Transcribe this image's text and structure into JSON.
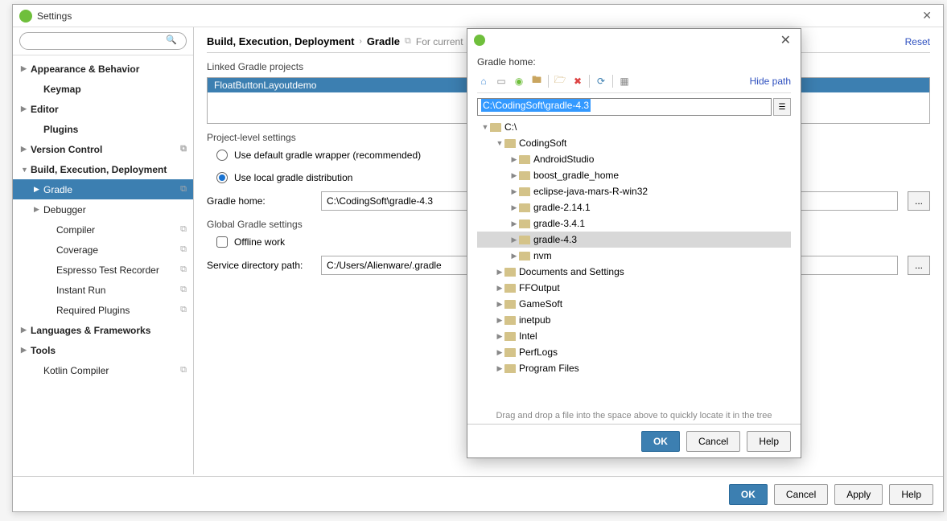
{
  "window": {
    "title": "Settings",
    "close": "✕"
  },
  "sidebar": {
    "search_placeholder": "",
    "items": [
      {
        "label": "Appearance & Behavior",
        "bold": true,
        "arrow": "▶",
        "level": 0
      },
      {
        "label": "Keymap",
        "bold": true,
        "level": 1
      },
      {
        "label": "Editor",
        "bold": true,
        "arrow": "▶",
        "level": 0
      },
      {
        "label": "Plugins",
        "bold": true,
        "level": 1
      },
      {
        "label": "Version Control",
        "bold": true,
        "arrow": "▶",
        "level": 0,
        "copy": true
      },
      {
        "label": "Build, Execution, Deployment",
        "bold": true,
        "arrow": "▼",
        "level": 0
      },
      {
        "label": "Gradle",
        "arrow": "▶",
        "level": 1,
        "selected": true,
        "copy": true
      },
      {
        "label": "Debugger",
        "arrow": "▶",
        "level": 1
      },
      {
        "label": "Compiler",
        "level": 2,
        "copy": true
      },
      {
        "label": "Coverage",
        "level": 2,
        "copy": true
      },
      {
        "label": "Espresso Test Recorder",
        "level": 2,
        "copy": true
      },
      {
        "label": "Instant Run",
        "level": 2,
        "copy": true
      },
      {
        "label": "Required Plugins",
        "level": 2,
        "copy": true
      },
      {
        "label": "Languages & Frameworks",
        "bold": true,
        "arrow": "▶",
        "level": 0
      },
      {
        "label": "Tools",
        "bold": true,
        "arrow": "▶",
        "level": 0
      },
      {
        "label": "Kotlin Compiler",
        "level": 1,
        "copy": true
      }
    ]
  },
  "content": {
    "breadcrumb_main": "Build, Execution, Deployment",
    "breadcrumb_sub": "Gradle",
    "breadcrumb_for": "For current",
    "reset": "Reset",
    "linked_label": "Linked Gradle projects",
    "project_name": "FloatButtonLayoutdemo",
    "project_level": "Project-level settings",
    "radio_default": "Use default gradle wrapper (recommended)",
    "radio_local": "Use local gradle distribution",
    "gradle_home_label": "Gradle home:",
    "gradle_home_value": "C:\\CodingSoft\\gradle-4.3",
    "global_label": "Global Gradle settings",
    "offline_label": "Offline work",
    "service_dir_label": "Service directory path:",
    "service_dir_value": "C:/Users/Alienware/.gradle",
    "browse": "..."
  },
  "modal": {
    "label": "Gradle home:",
    "hide_path": "Hide path",
    "path_value": "C:\\CodingSoft\\gradle-4.3",
    "tree": [
      {
        "label": "C:\\",
        "level": 0,
        "arrow": "▼"
      },
      {
        "label": "CodingSoft",
        "level": 1,
        "arrow": "▼"
      },
      {
        "label": "AndroidStudio",
        "level": 2,
        "arrow": "▶"
      },
      {
        "label": "boost_gradle_home",
        "level": 2,
        "arrow": "▶"
      },
      {
        "label": "eclipse-java-mars-R-win32",
        "level": 2,
        "arrow": "▶"
      },
      {
        "label": "gradle-2.14.1",
        "level": 2,
        "arrow": "▶"
      },
      {
        "label": "gradle-3.4.1",
        "level": 2,
        "arrow": "▶"
      },
      {
        "label": "gradle-4.3",
        "level": 2,
        "arrow": "▶",
        "selected": true
      },
      {
        "label": "nvm",
        "level": 2,
        "arrow": "▶"
      },
      {
        "label": "Documents and Settings",
        "level": 1,
        "arrow": "▶"
      },
      {
        "label": "FFOutput",
        "level": 1,
        "arrow": "▶"
      },
      {
        "label": "GameSoft",
        "level": 1,
        "arrow": "▶"
      },
      {
        "label": "inetpub",
        "level": 1,
        "arrow": "▶"
      },
      {
        "label": "Intel",
        "level": 1,
        "arrow": "▶"
      },
      {
        "label": "PerfLogs",
        "level": 1,
        "arrow": "▶"
      },
      {
        "label": "Program Files",
        "level": 1,
        "arrow": "▶"
      }
    ],
    "hint": "Drag and drop a file into the space above to quickly locate it in the tree",
    "ok": "OK",
    "cancel": "Cancel",
    "help": "Help"
  },
  "footer": {
    "ok": "OK",
    "cancel": "Cancel",
    "apply": "Apply",
    "help": "Help"
  }
}
